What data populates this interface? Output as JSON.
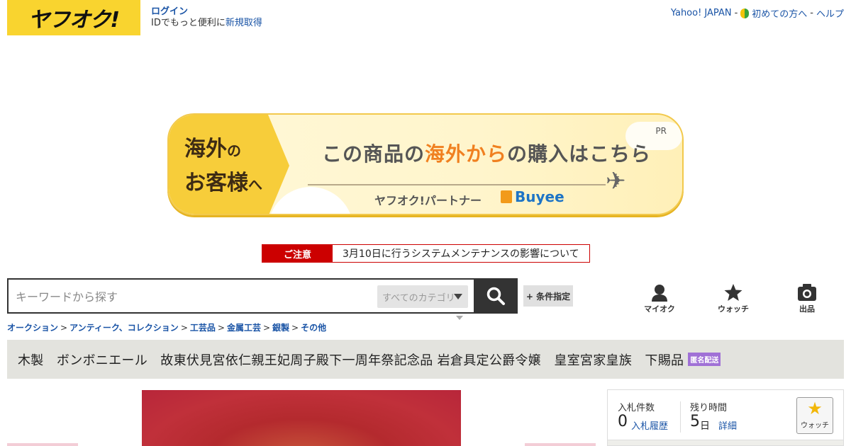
{
  "header": {
    "logo_text": "ヤフオク!",
    "login_label": "ログイン",
    "id_text": "IDでもっと便利に",
    "register_label": "新規取得",
    "top_links": {
      "yahoo_japan": "Yahoo! JAPAN",
      "sep1": "-",
      "beginners": "初めての方へ",
      "sep2": "-",
      "help": "ヘルプ"
    }
  },
  "banner": {
    "left_line1": "海外",
    "left_line1_small": "の",
    "left_line2": "お客様",
    "left_line2_small": "へ",
    "main_pre": "この商品の",
    "main_accent": "海外から",
    "main_post": "の購入はこちら",
    "partner_text": "ヤフオク!パートナー",
    "brand_text": "Buyee",
    "pr_label": "PR",
    "accent_color": "#f08020"
  },
  "notice": {
    "label": "ご注意",
    "text": "3月10日に行うシステムメンテナンスの影響について"
  },
  "search": {
    "placeholder": "キーワードから探す",
    "category_label": "すべてのカテゴリ",
    "condition_label": "+ 条件指定"
  },
  "nav": {
    "myauc": "マイオク",
    "watch": "ウォッチ",
    "sell": "出品"
  },
  "breadcrumb": [
    "オークション",
    "アンティーク、コレクション",
    "工芸品",
    "金属工芸",
    "銀製",
    "その他"
  ],
  "breadcrumb_sep": ">",
  "item": {
    "title": "木製　ボンボニエール　故東伏見宮依仁親王妃周子殿下一周年祭記念品 岩倉具定公爵令嬢　皇室宮家皇族　下賜品",
    "badge": "匿名配送"
  },
  "info": {
    "bids_label": "入札件数",
    "bids_count": "0",
    "bids_link": "入札履歴",
    "time_label": "残り時間",
    "time_value": "5",
    "time_unit": "日",
    "time_link": "詳細",
    "watch_label": "ウォッチ"
  }
}
